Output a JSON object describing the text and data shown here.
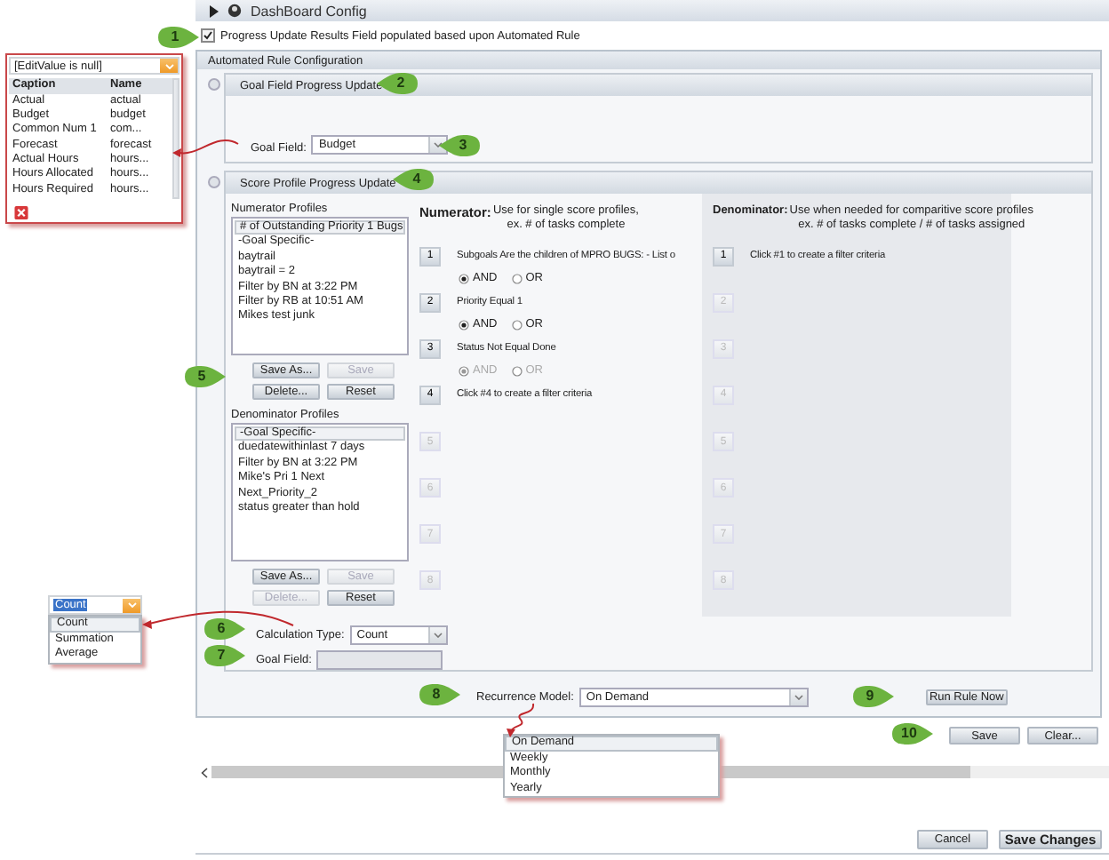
{
  "window": {
    "title": "DashBoard Config"
  },
  "auto_rule": {
    "label": "Progress Update Results Field populated based upon Automated Rule",
    "checked": true
  },
  "config": {
    "title": "Automated Rule Configuration"
  },
  "goal_section": {
    "title": "Goal Field Progress Update",
    "goal_field": {
      "label": "Goal Field:",
      "value": "Budget"
    }
  },
  "score_section": {
    "title": "Score Profile Progress Update",
    "profiles": [
      {
        "label": "Numerator Profiles",
        "items": [
          {
            "text": "# of Outstanding Priority 1 Bugs",
            "selected": true
          },
          {
            "text": "-Goal Specific-",
            "selected": false
          },
          {
            "text": "baytrail",
            "selected": false
          },
          {
            "text": "baytrail = 2",
            "selected": false
          },
          {
            "text": "Filter by BN at 3:22 PM",
            "selected": false
          },
          {
            "text": "Filter by RB at 10:51 AM",
            "selected": false
          },
          {
            "text": "Mikes test junk",
            "selected": false
          }
        ],
        "buttons": [
          {
            "label": "Save As...",
            "disabled": false
          },
          {
            "label": "Save",
            "disabled": true
          },
          {
            "label": "Delete...",
            "disabled": false
          },
          {
            "label": "Reset",
            "disabled": false
          }
        ]
      },
      {
        "label": "Denominator Profiles",
        "items": [
          {
            "text": "-Goal Specific-",
            "selected": true
          },
          {
            "text": "duedatewithinlast 7 days",
            "selected": false
          },
          {
            "text": "Filter by BN at 3:22 PM",
            "selected": false
          },
          {
            "text": "Mike's Pri 1 Next",
            "selected": false
          },
          {
            "text": "Next_Priority_2",
            "selected": false
          },
          {
            "text": "status greater than hold",
            "selected": false
          }
        ],
        "buttons": [
          {
            "label": "Save As...",
            "disabled": false
          },
          {
            "label": "Save",
            "disabled": true
          },
          {
            "label": "Delete...",
            "disabled": true
          },
          {
            "label": "Reset",
            "disabled": false
          }
        ]
      }
    ],
    "numerator": {
      "heading": "Numerator:",
      "description": [
        "Use for single score profiles,",
        "ex. # of tasks complete"
      ],
      "criteria": [
        {
          "number": "1",
          "text": "Subgoals Are the children of MPRO BUGS: - List o",
          "disabled": false,
          "logic": {
            "disabled": false,
            "options": [
              {
                "label": "AND",
                "selected": true
              },
              {
                "label": "OR",
                "selected": false
              }
            ]
          }
        },
        {
          "number": "2",
          "text": "Priority Equal 1",
          "disabled": false,
          "logic": {
            "disabled": false,
            "options": [
              {
                "label": "AND",
                "selected": true
              },
              {
                "label": "OR",
                "selected": false
              }
            ]
          }
        },
        {
          "number": "3",
          "text": "Status Not Equal Done",
          "disabled": false,
          "logic": {
            "disabled": true,
            "options": [
              {
                "label": "AND",
                "selected": true
              },
              {
                "label": "OR",
                "selected": false
              }
            ]
          }
        },
        {
          "number": "4",
          "text": "Click #4 to create a filter criteria",
          "disabled": false
        },
        {
          "number": "5",
          "disabled": true
        },
        {
          "number": "6",
          "disabled": true
        },
        {
          "number": "7",
          "disabled": true
        },
        {
          "number": "8",
          "disabled": true
        }
      ]
    },
    "denominator": {
      "heading": "Denominator:",
      "description": [
        "Use when needed for comparitive score profiles",
        "ex. # of tasks complete / # of tasks assigned"
      ],
      "criteria": [
        {
          "number": "1",
          "text": "Click #1 to create a filter criteria",
          "disabled": false
        },
        {
          "number": "2",
          "disabled": true
        },
        {
          "number": "3",
          "disabled": true
        },
        {
          "number": "4",
          "disabled": true
        },
        {
          "number": "5",
          "disabled": true
        },
        {
          "number": "6",
          "disabled": true
        },
        {
          "number": "7",
          "disabled": true
        },
        {
          "number": "8",
          "disabled": true
        }
      ]
    },
    "calculation_type": {
      "label": "Calculation Type:",
      "value": "Count"
    },
    "goal_field": {
      "label": "Goal Field:",
      "disabled": true
    }
  },
  "recurrence": {
    "label": "Recurrence Model:",
    "value": "On Demand"
  },
  "run_button": "Run Rule Now",
  "action_buttons": [
    "Save",
    "Clear..."
  ],
  "footer_buttons": [
    {
      "label": "Cancel",
      "kind": "normal"
    },
    {
      "label": "Save Changes",
      "kind": "primary"
    }
  ],
  "callouts": [
    "1",
    "2",
    "3",
    "4",
    "5",
    "6",
    "7",
    "8",
    "9",
    "10"
  ],
  "caption_popup": {
    "value": "[EditValue is null]",
    "columns": [
      "Caption",
      "Name"
    ],
    "rows": [
      [
        "Actual",
        "actual"
      ],
      [
        "Budget",
        "budget"
      ],
      [
        "Common Num 1",
        "com..."
      ],
      [
        "Forecast",
        "forecast"
      ],
      [
        "Actual Hours",
        "hours..."
      ],
      [
        "Hours Allocated",
        "hours..."
      ],
      [
        "Hours Required",
        "hours..."
      ]
    ]
  },
  "calc_popup": {
    "value": "Count",
    "options": [
      {
        "label": "Count",
        "selected": true
      },
      {
        "label": "Summation",
        "selected": false
      },
      {
        "label": "Average",
        "selected": false
      }
    ]
  },
  "recurrence_popup": {
    "options": [
      {
        "label": "On Demand",
        "selected": true
      },
      {
        "label": "Weekly",
        "selected": false
      },
      {
        "label": "Monthly",
        "selected": false
      },
      {
        "label": "Yearly",
        "selected": false
      }
    ]
  }
}
